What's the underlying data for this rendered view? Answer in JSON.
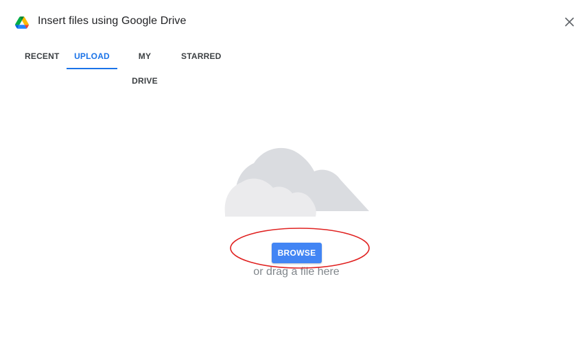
{
  "dialog": {
    "title": "Insert files using Google Drive",
    "logo_icon": "google-drive-logo",
    "close_icon": "close-icon"
  },
  "tabs": [
    {
      "label": "RECENT",
      "active": false
    },
    {
      "label": "UPLOAD",
      "active": true
    },
    {
      "label": "MY DRIVE",
      "active": false
    },
    {
      "label": "STARRED",
      "active": false
    }
  ],
  "upload": {
    "illustration_icon": "cloud-icon",
    "browse_label": "BROWSE",
    "drag_hint": "or drag a file here"
  },
  "colors": {
    "accent": "#1a73e8",
    "button": "#4285f4",
    "annotation": "#e0201f"
  }
}
